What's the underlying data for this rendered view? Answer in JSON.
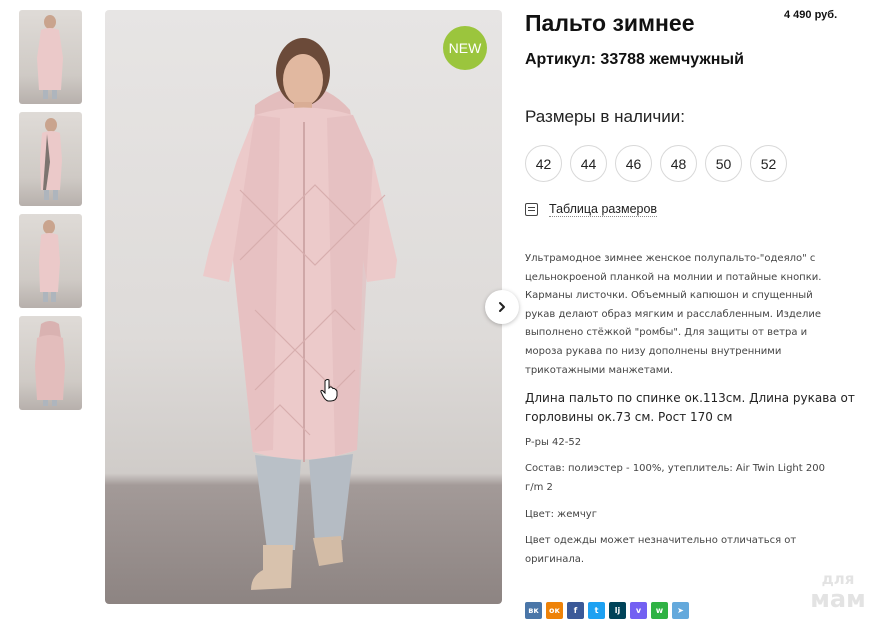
{
  "product": {
    "title": "Пальто зимнее",
    "price": "4 490 руб.",
    "article": "Артикул: 33788 жемчужный",
    "badge": "NEW"
  },
  "sizes": {
    "heading": "Размеры в наличии:",
    "items": [
      "42",
      "44",
      "46",
      "48",
      "50",
      "52"
    ],
    "table_link": "Таблица размеров"
  },
  "description": {
    "main": "Ультрамодное зимнее женское полупальто-\"одеяло\" с цельнокроеной планкой на молнии и потайные кнопки. Карманы листочки. Объемный капюшон и спущенный рукав делают образ мягким и расслабленным. Изделие выполнено стёжкой \"ромбы\". Для защиты от ветра и мороза рукава по низу дополнены внутренними трикотажными манжетами.",
    "measurements": "Длина пальто по спинке ок.113см. Длина рукава от горловины ок.73 см. Рост 170 см",
    "size_range": "Р-ры 42-52",
    "composition": "Состав: полиэстер - 100%, утеплитель: Air Twin Light 200 г/m 2",
    "color": "Цвет: жемчуг",
    "disclaimer": "Цвет одежды может незначительно отличаться от оригинала."
  },
  "share": [
    {
      "name": "vk",
      "icon": "vk-icon",
      "label": "вк",
      "color": "#4a76a8"
    },
    {
      "name": "ok",
      "icon": "odnoklassniki-icon",
      "label": "ок",
      "color": "#ee8208"
    },
    {
      "name": "facebook",
      "icon": "facebook-icon",
      "label": "f",
      "color": "#3b5998"
    },
    {
      "name": "twitter",
      "icon": "twitter-icon",
      "label": "t",
      "color": "#1da1f2"
    },
    {
      "name": "livejournal",
      "icon": "livejournal-icon",
      "label": "lj",
      "color": "#004359"
    },
    {
      "name": "viber",
      "icon": "viber-icon",
      "label": "v",
      "color": "#7360f2"
    },
    {
      "name": "whatsapp",
      "icon": "whatsapp-icon",
      "label": "w",
      "color": "#2fb244"
    },
    {
      "name": "telegram",
      "icon": "telegram-icon",
      "label": "➤",
      "color": "#64a9dc"
    }
  ],
  "watermark": {
    "small": "для",
    "big": "мам"
  },
  "colors": {
    "accent_new": "#9bc53d",
    "coat_pink": "#e8c5c5"
  },
  "thumbnails": [
    "thumbnail-front",
    "thumbnail-side",
    "thumbnail-side-2",
    "thumbnail-back"
  ]
}
